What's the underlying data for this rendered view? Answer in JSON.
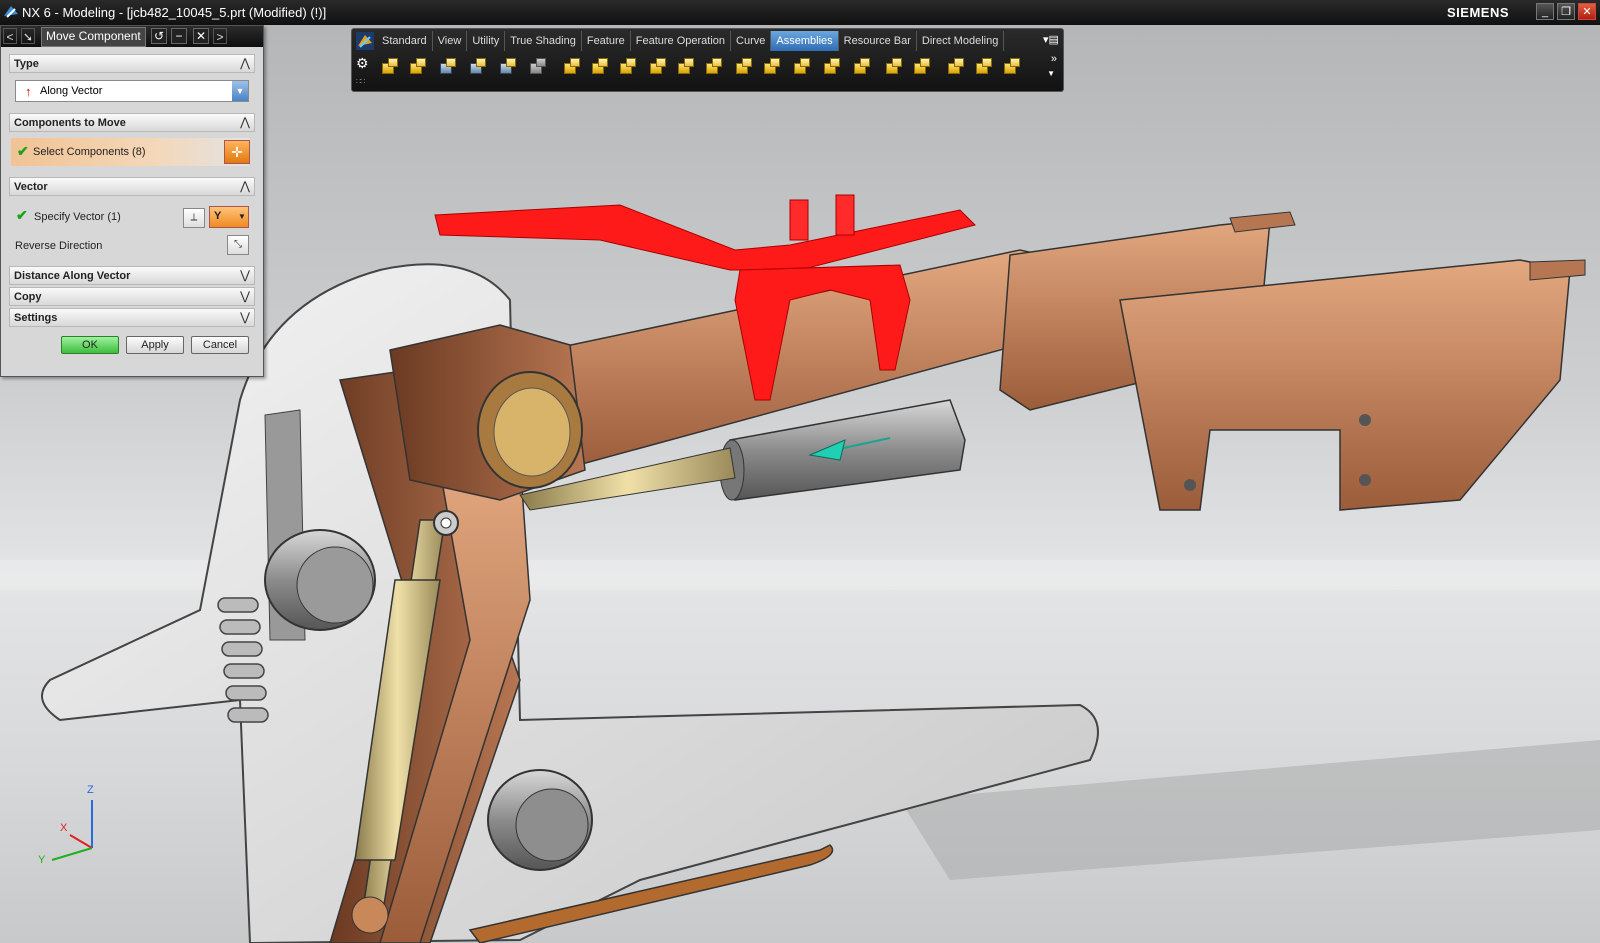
{
  "window": {
    "title": "NX 6 - Modeling - [jcb482_10045_5.prt (Modified)    (!)]",
    "brand": "SIEMENS",
    "minimize": "_",
    "restore": "❐",
    "close": "✕"
  },
  "dialog": {
    "title": "Move Component",
    "back": "<",
    "forward": ">",
    "reset": "↺",
    "minimize": "−",
    "close": "✕",
    "sections": {
      "type": "Type",
      "components": "Components to Move",
      "vector": "Vector",
      "distance": "Distance Along Vector",
      "copy": "Copy",
      "settings": "Settings"
    },
    "type_value": "Along Vector",
    "select_components": "Select Components (8)",
    "specify_vector": "Specify Vector (1)",
    "vector_axis": "Y",
    "reverse_direction": "Reverse Direction",
    "buttons": {
      "ok": "OK",
      "apply": "Apply",
      "cancel": "Cancel"
    }
  },
  "toolbar": {
    "tabs": [
      "Standard",
      "View",
      "Utility",
      "True Shading",
      "Feature",
      "Feature Operation",
      "Curve",
      "Assemblies",
      "Resource Bar",
      "Direct Modeling"
    ],
    "active_tab": "Assemblies",
    "more": "»"
  },
  "triad": {
    "x": "X",
    "y": "Y",
    "z": "Z"
  },
  "colors": {
    "accent_active_tab": "#3f7fc4",
    "selected_part": "#ff1a1a",
    "copper": "#c98a62",
    "ok_green": "#3dbd3d"
  }
}
